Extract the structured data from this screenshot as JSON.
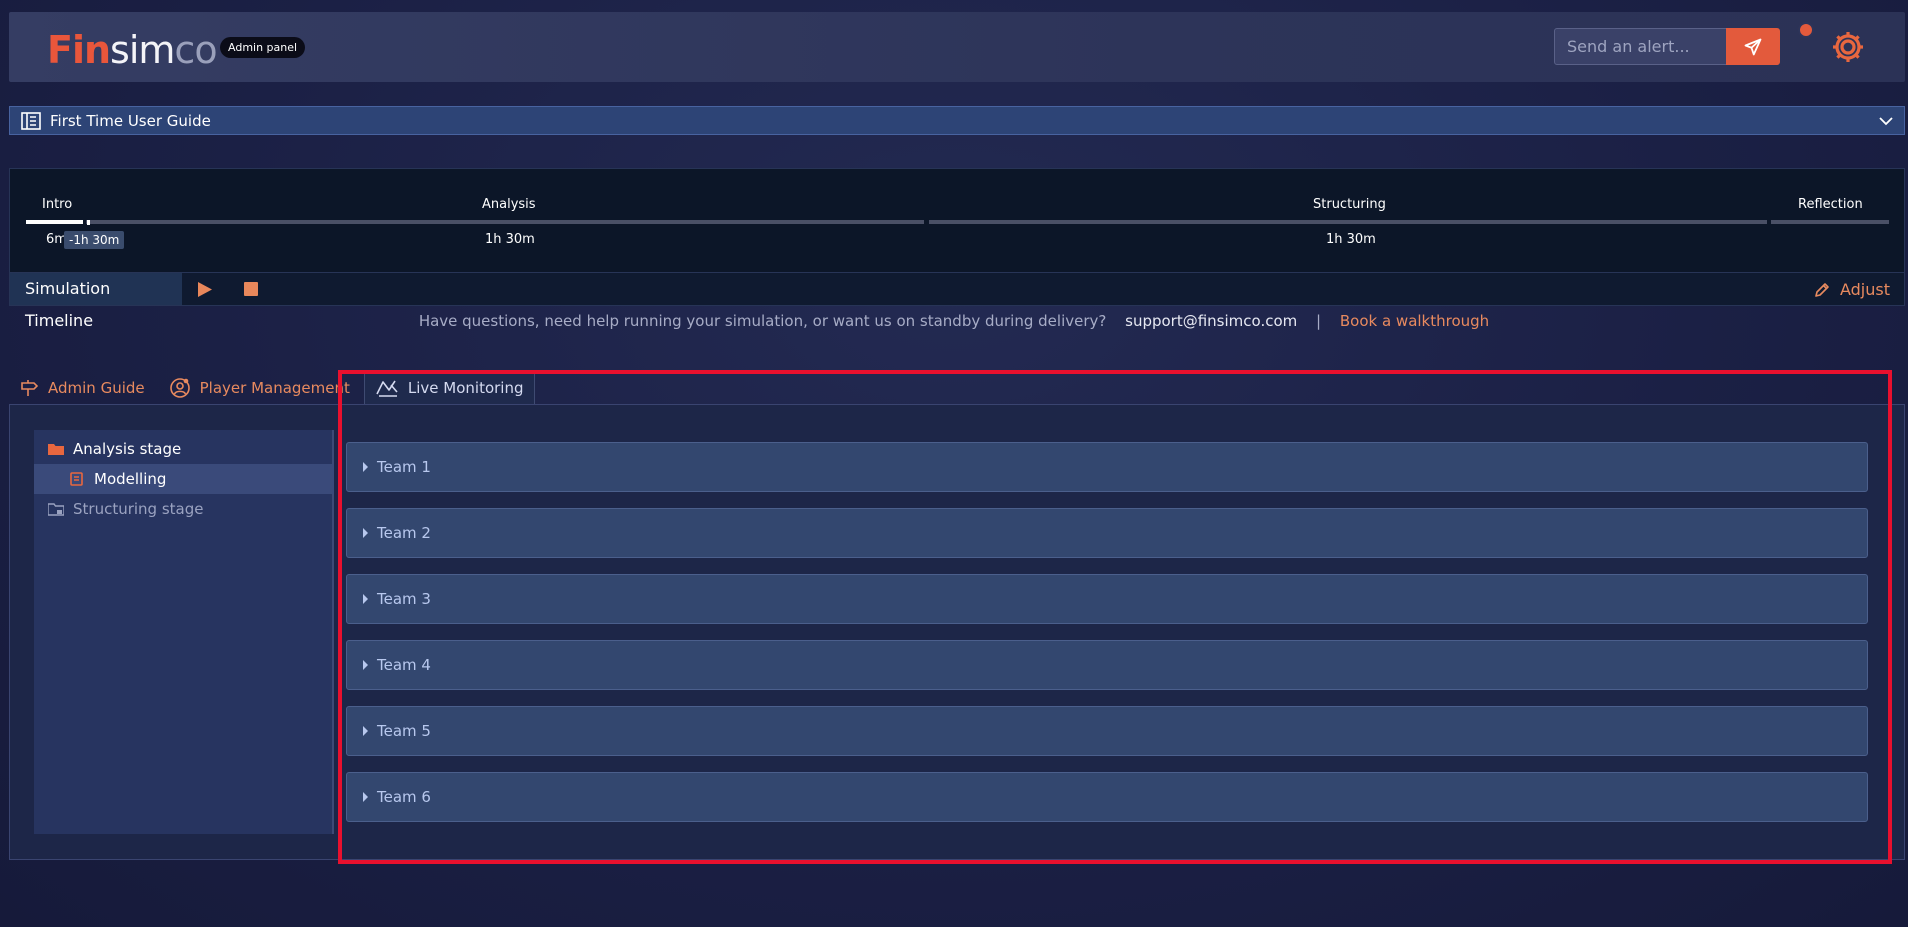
{
  "header": {
    "logo": {
      "part1": "Fin",
      "part2": "sim",
      "part3": "co"
    },
    "admin_badge": "Admin panel",
    "alert_placeholder": "Send an alert...",
    "accent_color": "#e35a3c"
  },
  "guide": {
    "title": "First Time User Guide"
  },
  "timeline": {
    "stages": [
      {
        "name": "Intro",
        "duration": "6m",
        "overdue": "-1h 30m"
      },
      {
        "name": "Analysis",
        "duration": "1h 30m"
      },
      {
        "name": "Structuring",
        "duration": "1h 30m"
      },
      {
        "name": "Reflection",
        "duration": ""
      }
    ],
    "title": "Simulation Timeline",
    "adjust_label": "Adjust"
  },
  "help": {
    "question": "Have questions, need help running your simulation, or want us on standby during delivery?",
    "email": "support@finsimco.com",
    "separator": "|",
    "walkthrough": "Book a walkthrough"
  },
  "tabs": [
    {
      "label": "Admin Guide",
      "icon": "signpost-icon"
    },
    {
      "label": "Player Management",
      "icon": "user-gear-icon"
    },
    {
      "label": "Live Monitoring",
      "icon": "monitoring-icon",
      "active": true
    }
  ],
  "tree": {
    "items": [
      {
        "label": "Analysis stage",
        "icon": "folder-icon"
      },
      {
        "label": "Modelling",
        "icon": "scroll-icon",
        "selected": true
      },
      {
        "label": "Structuring stage",
        "icon": "folder-locked-icon"
      }
    ]
  },
  "teams": [
    "Team 1",
    "Team 2",
    "Team 3",
    "Team 4",
    "Team 5",
    "Team 6"
  ]
}
